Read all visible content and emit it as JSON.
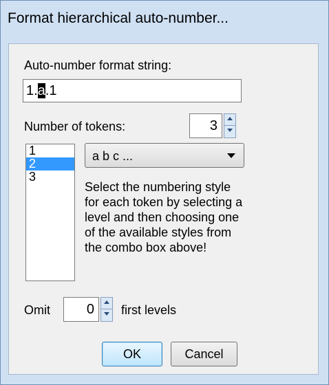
{
  "dialog": {
    "title": "Format hierarchical auto-number..."
  },
  "format": {
    "label": "Auto-number format string:",
    "value_before": "1.",
    "value_selected": "a",
    "value_after": ".1"
  },
  "tokens": {
    "label": "Number of tokens:",
    "value": "3"
  },
  "levels": {
    "items": [
      "1",
      "2",
      "3"
    ],
    "selected_index": 1
  },
  "style_combo": {
    "value": "a b c ..."
  },
  "help_text": "Select the numbering style for each token by selecting a level and then choosing one of the available styles from the combo box above!",
  "omit": {
    "label_before": "Omit",
    "value": "0",
    "label_after": "first levels"
  },
  "buttons": {
    "ok": "OK",
    "cancel": "Cancel"
  },
  "colors": {
    "selection": "#3399ff",
    "frame": "#cfe0f3"
  }
}
